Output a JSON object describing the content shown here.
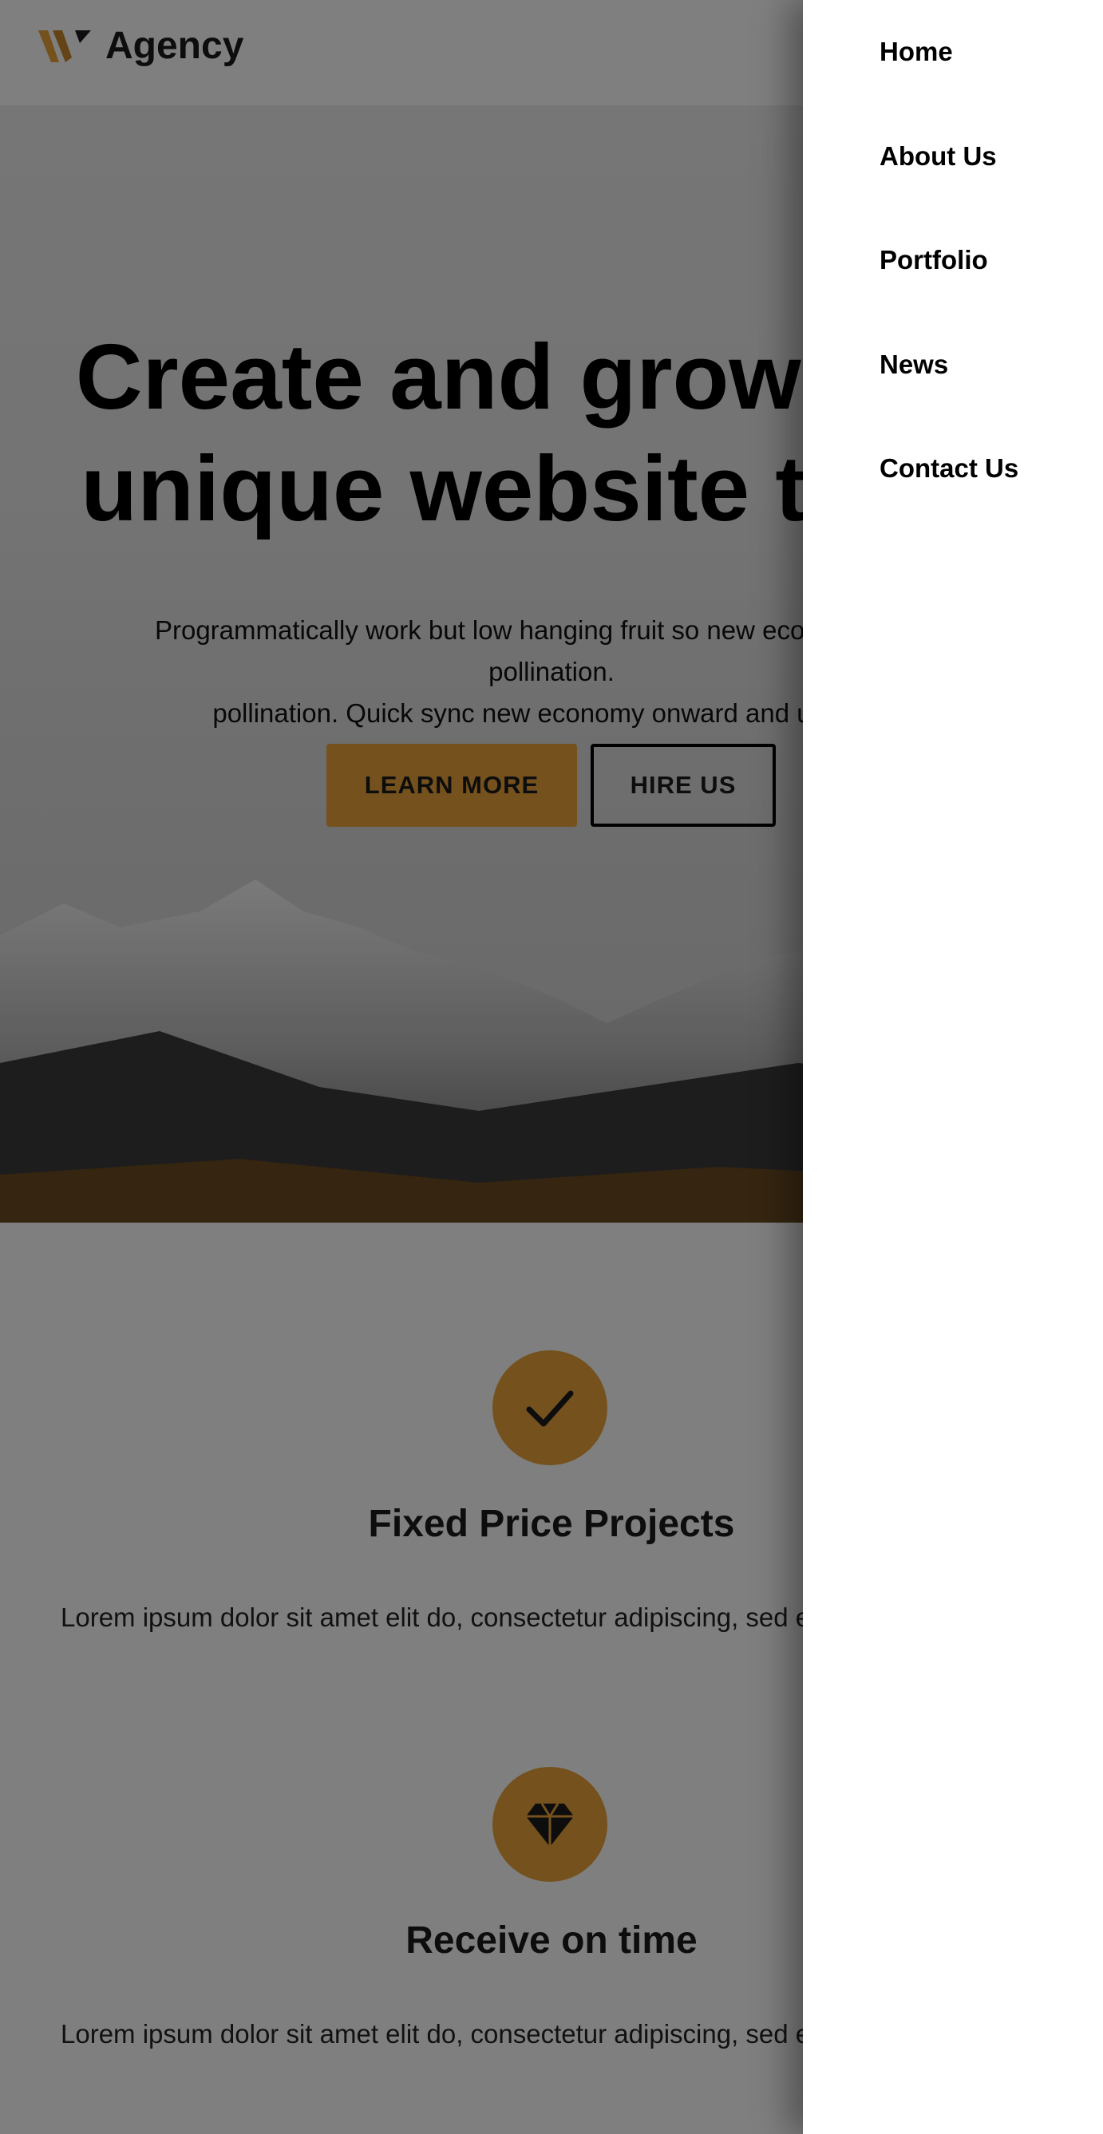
{
  "header": {
    "logo_icon": "w-mark-icon",
    "brand": "Agency"
  },
  "hero": {
    "title_line1": "Create and grow your",
    "title_line2": "unique website today",
    "subtitle_line1": "Programmatically work but low hanging fruit so new economy cross-pollination.",
    "subtitle_line2": "pollination. Quick sync new economy onward and upward.",
    "learn_more": "LEARN MORE",
    "hire_us": "HIRE US"
  },
  "features": [
    {
      "icon": "checkmark-icon",
      "title": "Fixed Price Projects",
      "text": "Lorem ipsum dolor sit amet elit do, consectetur adipiscing, sed eiusmod tempor."
    },
    {
      "icon": "diamond-icon",
      "title": "Receive on time",
      "text": "Lorem ipsum dolor sit amet elit do, consectetur adipiscing, sed eiusmod tempor."
    }
  ],
  "nav": {
    "items": [
      "Home",
      "About Us",
      "Portfolio",
      "News",
      "Contact Us"
    ]
  },
  "colors": {
    "accent": "#e9a23b",
    "overlay": "rgba(0,0,0,0.5)",
    "drawer_bg": "#ffffff"
  }
}
